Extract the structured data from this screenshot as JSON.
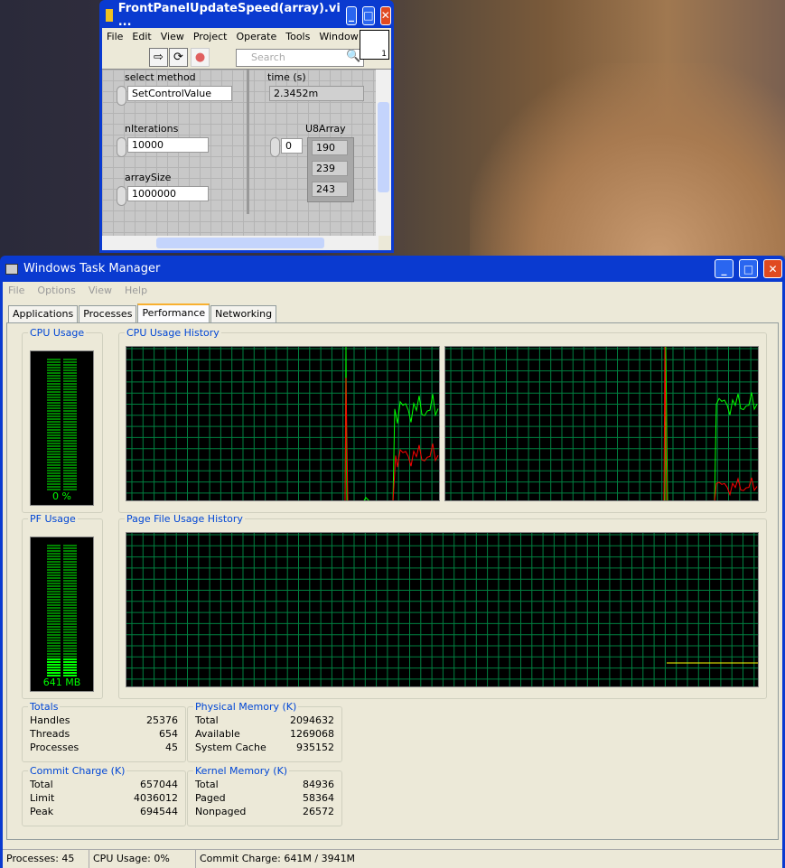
{
  "labview": {
    "title": "FrontPanelUpdateSpeed(array).vi ...",
    "menu": [
      "File",
      "Edit",
      "View",
      "Project",
      "Operate",
      "Tools",
      "Window"
    ],
    "search_placeholder": "Search",
    "icon_badge": "1",
    "select_method": {
      "label": "select method",
      "value": "SetControlValue"
    },
    "time": {
      "label": "time (s)",
      "value": "2.3452m"
    },
    "nIterations": {
      "label": "nIterations",
      "value": "10000"
    },
    "arraySize": {
      "label": "arraySize",
      "value": "1000000"
    },
    "u8array": {
      "label": "U8Array",
      "index": "0",
      "values": [
        "190",
        "239",
        "243"
      ]
    }
  },
  "taskmanager": {
    "title": "Windows Task Manager",
    "menu": [
      "File",
      "Options",
      "View",
      "Help"
    ],
    "tabs": [
      "Applications",
      "Processes",
      "Performance",
      "Networking"
    ],
    "active_tab": "Performance",
    "cpu_usage": {
      "label": "CPU Usage",
      "value": "0 %",
      "percent": 0
    },
    "cpu_history": {
      "label": "CPU Usage History"
    },
    "pf_usage": {
      "label": "PF Usage",
      "value": "641 MB",
      "fraction": 0.16
    },
    "pf_history": {
      "label": "Page File Usage History"
    },
    "totals": {
      "label": "Totals",
      "rows": [
        [
          "Handles",
          "25376"
        ],
        [
          "Threads",
          "654"
        ],
        [
          "Processes",
          "45"
        ]
      ]
    },
    "physical": {
      "label": "Physical Memory (K)",
      "rows": [
        [
          "Total",
          "2094632"
        ],
        [
          "Available",
          "1269068"
        ],
        [
          "System Cache",
          "935152"
        ]
      ]
    },
    "commit": {
      "label": "Commit Charge (K)",
      "rows": [
        [
          "Total",
          "657044"
        ],
        [
          "Limit",
          "4036012"
        ],
        [
          "Peak",
          "694544"
        ]
      ]
    },
    "kernel": {
      "label": "Kernel Memory (K)",
      "rows": [
        [
          "Total",
          "84936"
        ],
        [
          "Paged",
          "58364"
        ],
        [
          "Nonpaged",
          "26572"
        ]
      ]
    },
    "status": {
      "processes": "Processes: 45",
      "cpu": "CPU Usage: 0%",
      "commit": "Commit Charge: 641M / 3941M"
    },
    "colors": {
      "total": "#00ff00",
      "kernel": "#ff0000",
      "pf": "#ffff00",
      "grid": "#008040"
    }
  }
}
